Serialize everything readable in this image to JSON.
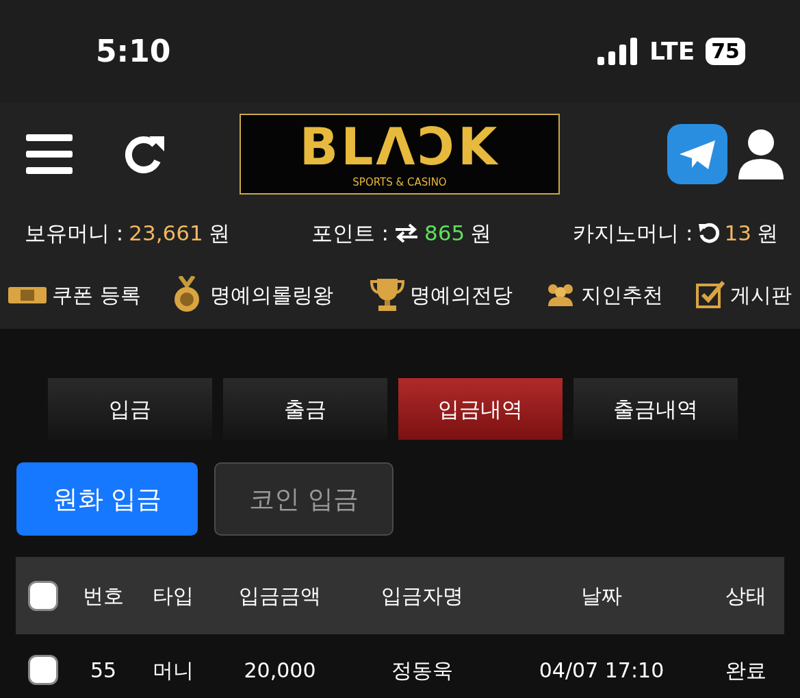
{
  "status_bar": {
    "time": "5:10",
    "network": "LTE",
    "battery": "75"
  },
  "header": {
    "logo": {
      "title": "BLΛƆK",
      "subtitle": "SPORTS & CASINO"
    }
  },
  "balances": [
    {
      "label": "보유머니 :",
      "kind": "plain",
      "amount": "23,661",
      "unit": "원",
      "color": "#f0b860"
    },
    {
      "label": "포인트 :",
      "kind": "exchange",
      "amount": "865",
      "unit": "원",
      "color": "#5ee05e"
    },
    {
      "label": "카지노머니 :",
      "kind": "reload",
      "amount": "13",
      "unit": "원",
      "color": "#f0b860"
    }
  ],
  "quick_links": [
    {
      "label": "쿠폰 등록",
      "kind": "coupon"
    },
    {
      "label": "명예의롤링왕",
      "kind": "ranking"
    },
    {
      "label": "명예의전당",
      "kind": "fame"
    },
    {
      "label": "지인추천",
      "kind": "referral"
    },
    {
      "label": "게시판",
      "kind": "board"
    }
  ],
  "tabs": [
    {
      "label": "입금",
      "selected": false
    },
    {
      "label": "출금",
      "selected": false
    },
    {
      "label": "입금내역",
      "selected": true
    },
    {
      "label": "출금내역",
      "selected": false
    }
  ],
  "deposit_types": [
    {
      "label": "원화 입금",
      "selected": true
    },
    {
      "label": "코인 입금",
      "selected": false
    }
  ],
  "table": {
    "select_all_checked": false,
    "columns": [
      "번호",
      "타입",
      "입금금액",
      "입금자명",
      "날짜",
      "상태"
    ],
    "rows": [
      {
        "checked": false,
        "cells": [
          "55",
          "머니",
          "20,000",
          "정동욱",
          "04/07 17:10",
          "완료"
        ]
      }
    ]
  }
}
